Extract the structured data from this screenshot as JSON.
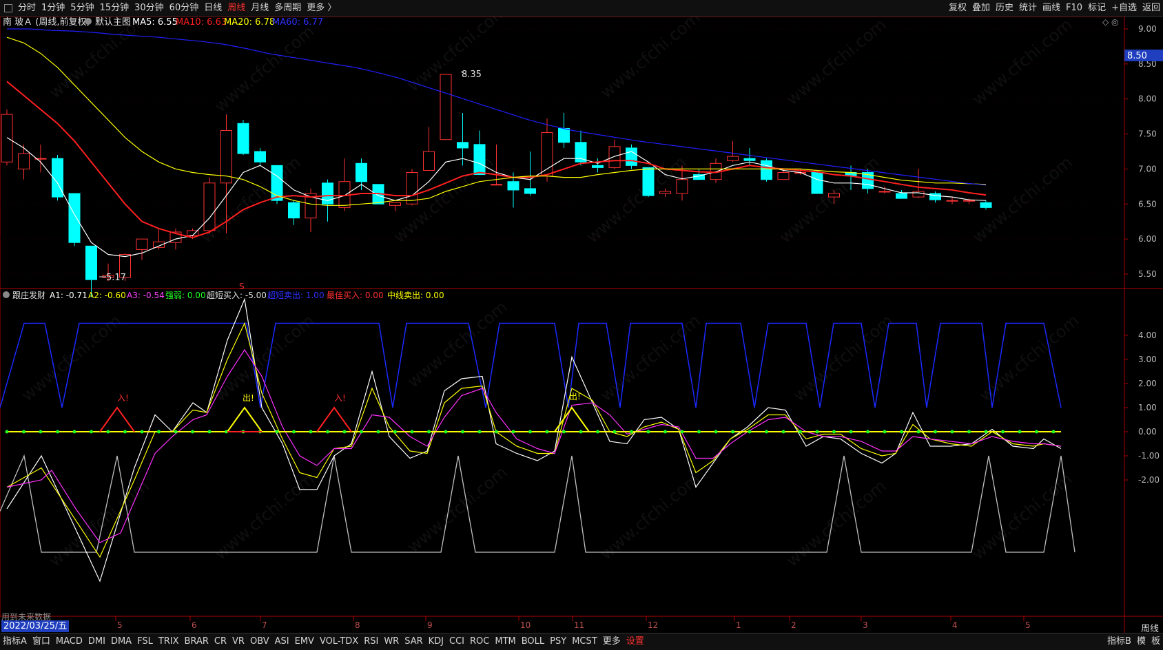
{
  "toolbar": {
    "left_items": [
      "分时",
      "1分钟",
      "5分钟",
      "15分钟",
      "30分钟",
      "60分钟",
      "日线",
      "周线",
      "月线",
      "多周期",
      "更多 〉"
    ],
    "active_index": 7,
    "right_items": [
      "复权",
      "叠加",
      "历史",
      "统计",
      "画线",
      "F10",
      "标记",
      "+自选",
      "返回"
    ]
  },
  "main_legend": {
    "stock": "南 玻Ａ (周线,前复权)",
    "template": "默认主图",
    "ma5": "MA5: 6.55",
    "ma10": "MA10: 6.63",
    "ma20": "MA20: 6.78",
    "ma60": "MA60: 6.77"
  },
  "price_axis": {
    "ticks": [
      "9.00",
      "8.50",
      "8.00",
      "7.50",
      "7.00",
      "6.50",
      "6.00",
      "5.50"
    ],
    "current_price": "8.50"
  },
  "annotations": {
    "high": "8.35",
    "low": "5.17",
    "s_mark": "S"
  },
  "indicator_legend": {
    "name": "跟庄发财",
    "a1": "A1: -0.71",
    "a2": "A2: -0.60",
    "a3": "A3: -0.54",
    "qiangruo": "强弱: 0.00",
    "chaoduan_buy": "超短买入: -5.00",
    "chaoduan_sell": "超短卖出: 1.00",
    "best_buy": "最佳买入: 0.00",
    "mid_sell": "中线卖出: 0.00"
  },
  "indicator_axis": {
    "ticks": [
      "4.00",
      "3.00",
      "2.00",
      "1.00",
      "0.00",
      "-1.00",
      "-2.00"
    ]
  },
  "signals": {
    "buy": "入!",
    "sell": "出!"
  },
  "time_axis": {
    "labels": [
      "5",
      "6",
      "7",
      "8",
      "9",
      "10",
      "11",
      "12",
      "1",
      "2",
      "3",
      "4",
      "5"
    ]
  },
  "status": {
    "date": "2022/03/25/五",
    "future_text": "用到未来数据",
    "period_right": "周线"
  },
  "bottom_tabs": [
    "指标A",
    "窗口",
    "MACD",
    "DMI",
    "DMA",
    "FSL",
    "TRIX",
    "BRAR",
    "CR",
    "VR",
    "OBV",
    "ASI",
    "EMV",
    "VOL-TDX",
    "RSI",
    "WR",
    "SAR",
    "KDJ",
    "CCI",
    "ROC",
    "MTM",
    "BOLL",
    "PSY",
    "MCST",
    "更多",
    "设置"
  ],
  "bottom_right": [
    "指标B",
    "模",
    "板"
  ],
  "watermark": "www.cfchi.com",
  "colors": {
    "up": "#ff3232",
    "down": "#00ffff",
    "ma5": "#ffffff",
    "ma10": "#ff2020",
    "ma20": "#ffff00",
    "ma60": "#2020ff",
    "axis": "#b00000"
  }
}
